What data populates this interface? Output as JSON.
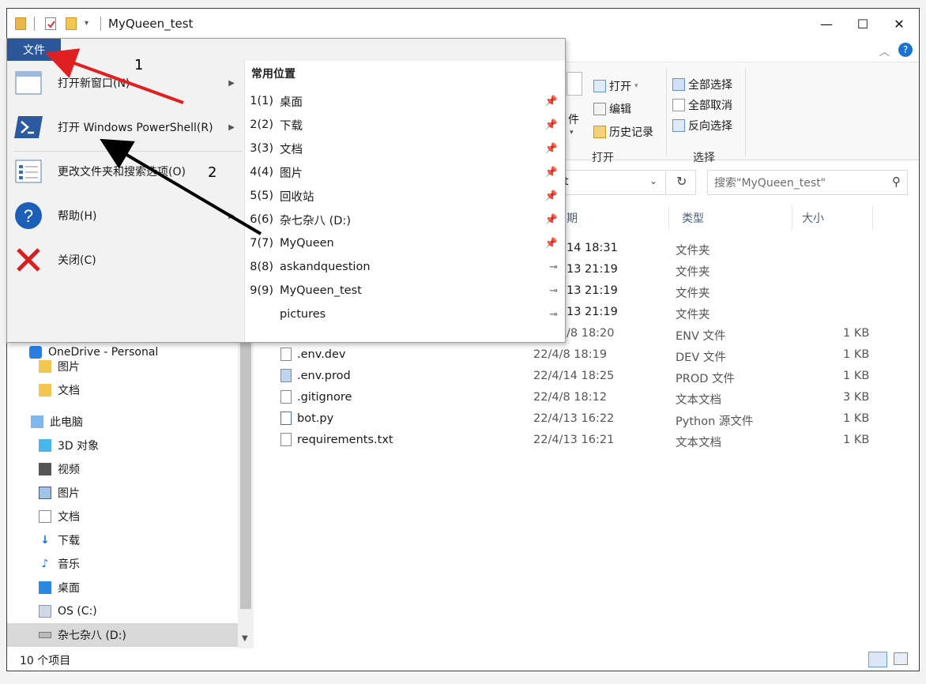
{
  "window": {
    "title": "MyQueen_test",
    "minimize_glyph": "—",
    "maximize_glyph": "☐",
    "close_glyph": "✕"
  },
  "ribbon": {
    "open_group": {
      "open_label": "打开",
      "edit_label": "编辑",
      "history_label": "历史记录",
      "group_label": "打开",
      "partial_label": "件"
    },
    "select_group": {
      "select_all": "全部选择",
      "select_none": "全部取消",
      "invert": "反向选择",
      "group_label": "选择"
    }
  },
  "address": {
    "partial_text": "t",
    "search_placeholder": "搜索\"MyQueen_test\""
  },
  "file_menu": {
    "tab_label": "文件",
    "commands": [
      {
        "label": "打开新窗口(N)",
        "icon": "new-window-icon",
        "has_submenu": true
      },
      {
        "label": "打开 Windows PowerShell(R)",
        "icon": "powershell-icon",
        "has_submenu": true
      },
      {
        "label": "更改文件夹和搜索选项(O)",
        "icon": "folder-options-icon",
        "has_submenu": false
      },
      {
        "label": "帮助(H)",
        "icon": "help-icon",
        "has_submenu": true
      },
      {
        "label": "关闭(C)",
        "icon": "close-icon",
        "has_submenu": false
      }
    ],
    "recent_title": "常用位置",
    "recent": [
      {
        "num": "1(1)",
        "name": "桌面",
        "pinned": true
      },
      {
        "num": "2(2)",
        "name": "下载",
        "pinned": true
      },
      {
        "num": "3(3)",
        "name": "文档",
        "pinned": true
      },
      {
        "num": "4(4)",
        "name": "图片",
        "pinned": true
      },
      {
        "num": "5(5)",
        "name": "回收站",
        "pinned": true
      },
      {
        "num": "6(6)",
        "name": "杂七杂八 (D:)",
        "pinned": true
      },
      {
        "num": "7(7)",
        "name": "MyQueen",
        "pinned": true
      },
      {
        "num": "8(8)",
        "name": "askandquestion",
        "pinned": false
      },
      {
        "num": "9(9)",
        "name": "MyQueen_test",
        "pinned": false
      },
      {
        "num": "",
        "name": "pictures",
        "pinned": false
      }
    ]
  },
  "annotations": {
    "label_1": "1",
    "label_2": "2"
  },
  "nav": {
    "partial_onedrive": "OneDrive - Personal",
    "items": [
      {
        "label": "图片",
        "icon": "folder-icon"
      },
      {
        "label": "文档",
        "icon": "folder-icon"
      },
      {
        "label": "此电脑",
        "icon": "this-pc-icon"
      },
      {
        "label": "3D 对象",
        "icon": "3d-objects-icon"
      },
      {
        "label": "视频",
        "icon": "video-icon"
      },
      {
        "label": "图片",
        "icon": "pictures-icon"
      },
      {
        "label": "文档",
        "icon": "documents-icon"
      },
      {
        "label": "下载",
        "icon": "download-icon"
      },
      {
        "label": "音乐",
        "icon": "music-icon"
      },
      {
        "label": "桌面",
        "icon": "desktop-icon"
      },
      {
        "label": "OS (C:)",
        "icon": "drive-c-icon"
      },
      {
        "label": "杂七杂八 (D:)",
        "icon": "drive-d-icon"
      }
    ]
  },
  "columns": {
    "date_partial": "期",
    "type": "类型",
    "size": "大小"
  },
  "files": [
    {
      "name": "",
      "date": "14 18:31",
      "type": "文件夹",
      "size": ""
    },
    {
      "name": "",
      "date": "13 21:19",
      "type": "文件夹",
      "size": ""
    },
    {
      "name": "",
      "date": "13 21:19",
      "type": "文件夹",
      "size": ""
    },
    {
      "name": "",
      "date": "13 21:19",
      "type": "文件夹",
      "size": ""
    },
    {
      "name": "",
      "date": "/8 18:20",
      "type": "ENV 文件",
      "size": "1 KB"
    },
    {
      "name": ".env.dev",
      "date": "22/4/8 18:19",
      "type": "DEV 文件",
      "size": "1 KB"
    },
    {
      "name": ".env.prod",
      "date": "22/4/14 18:25",
      "type": "PROD 文件",
      "size": "1 KB"
    },
    {
      "name": ".gitignore",
      "date": "22/4/8 18:12",
      "type": "文本文档",
      "size": "3 KB"
    },
    {
      "name": "bot.py",
      "date": "22/4/13 16:22",
      "type": "Python 源文件",
      "size": "1 KB"
    },
    {
      "name": "requirements.txt",
      "date": "22/4/13 16:21",
      "type": "文本文档",
      "size": "1 KB"
    }
  ],
  "status": {
    "item_count": "10 个项目"
  },
  "colors": {
    "file_tab": "#2b579a",
    "red_arrow": "#e02020",
    "black_arrow": "#000000"
  }
}
